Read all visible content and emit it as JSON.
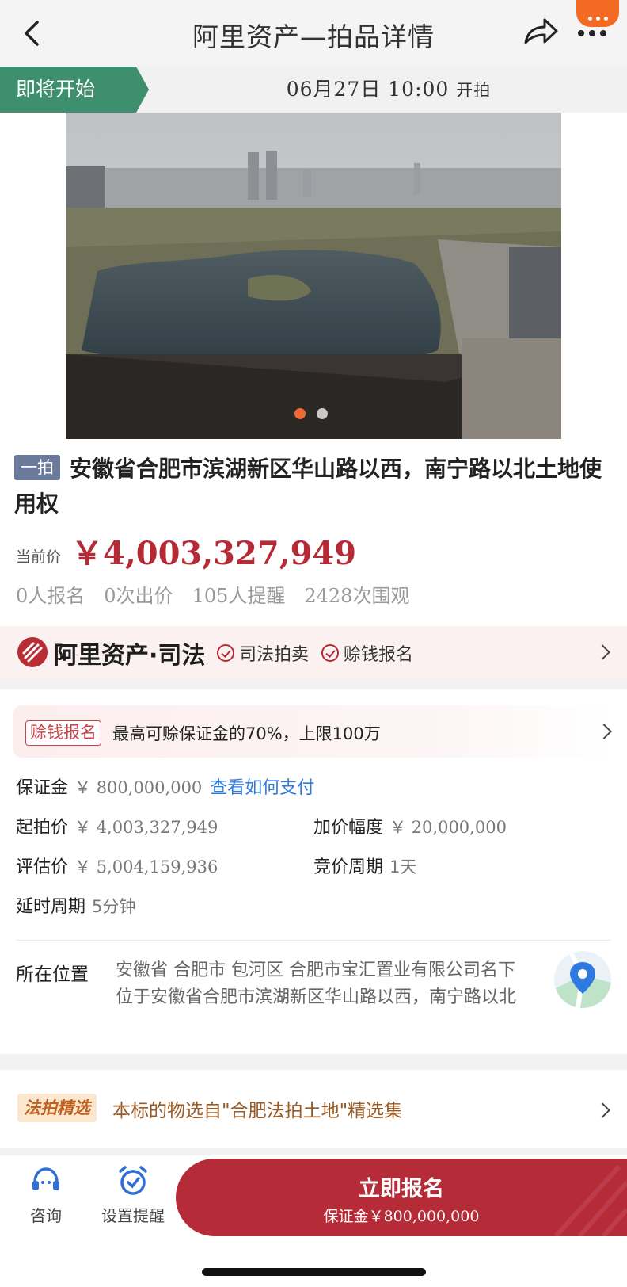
{
  "header": {
    "title": "阿里资产—拍品详情"
  },
  "start_bar": {
    "tag": "即将开始",
    "time": "06月27日 10:00",
    "suffix": "开拍"
  },
  "gallery": {
    "pages": 2,
    "current": 1
  },
  "item": {
    "round_tag": "一拍",
    "title": "安徽省合肥市滨湖新区华山路以西，南宁路以北土地使用权",
    "price_label": "当前价",
    "price": "￥4,003,327,949",
    "stats": [
      "0人报名",
      "0次出价",
      "105人提醒",
      "2428次围观"
    ]
  },
  "judicial": {
    "brand": "阿里资产·司法",
    "badges": [
      "司法拍卖",
      "赊钱报名"
    ]
  },
  "details": {
    "earn_tag": "赊钱报名",
    "earn_text": "最高可赊保证金的70%，上限100万",
    "deposit_label": "保证金",
    "deposit_value": "￥ 800,000,000",
    "deposit_link": "查看如何支付",
    "start_price_label": "起拍价",
    "start_price_value": "￥ 4,003,327,949",
    "increment_label": "加价幅度",
    "increment_value": "￥ 20,000,000",
    "appraisal_label": "评估价",
    "appraisal_value": "￥ 5,004,159,936",
    "cycle_label": "竞价周期",
    "cycle_value": "1天",
    "delay_label": "延时周期",
    "delay_value": "5分钟",
    "location_label": "所在位置",
    "location_text": "安徽省 合肥市 包河区 合肥市宝汇置业有限公司名下位于安徽省合肥市滨湖新区华山路以西，南宁路以北"
  },
  "selection": {
    "tag": "法拍精选",
    "text": "本标的物选自\"合肥法拍土地\"精选集"
  },
  "bottom_bar": {
    "consult": "咨询",
    "remind": "设置提醒",
    "apply_label": "立即报名",
    "apply_sub_label": "保证金",
    "apply_sub_value": "￥800,000,000"
  },
  "colors": {
    "accent_red": "#b52a35",
    "start_green": "#3d8f6e",
    "link_blue": "#2f7ae0",
    "notif_orange": "#f36b22"
  },
  "icons": [
    "back-arrow-icon",
    "share-icon",
    "more-icon",
    "check-circle-icon",
    "chevron-right-icon",
    "map-pin-icon",
    "headset-icon",
    "alarm-clock-icon"
  ]
}
